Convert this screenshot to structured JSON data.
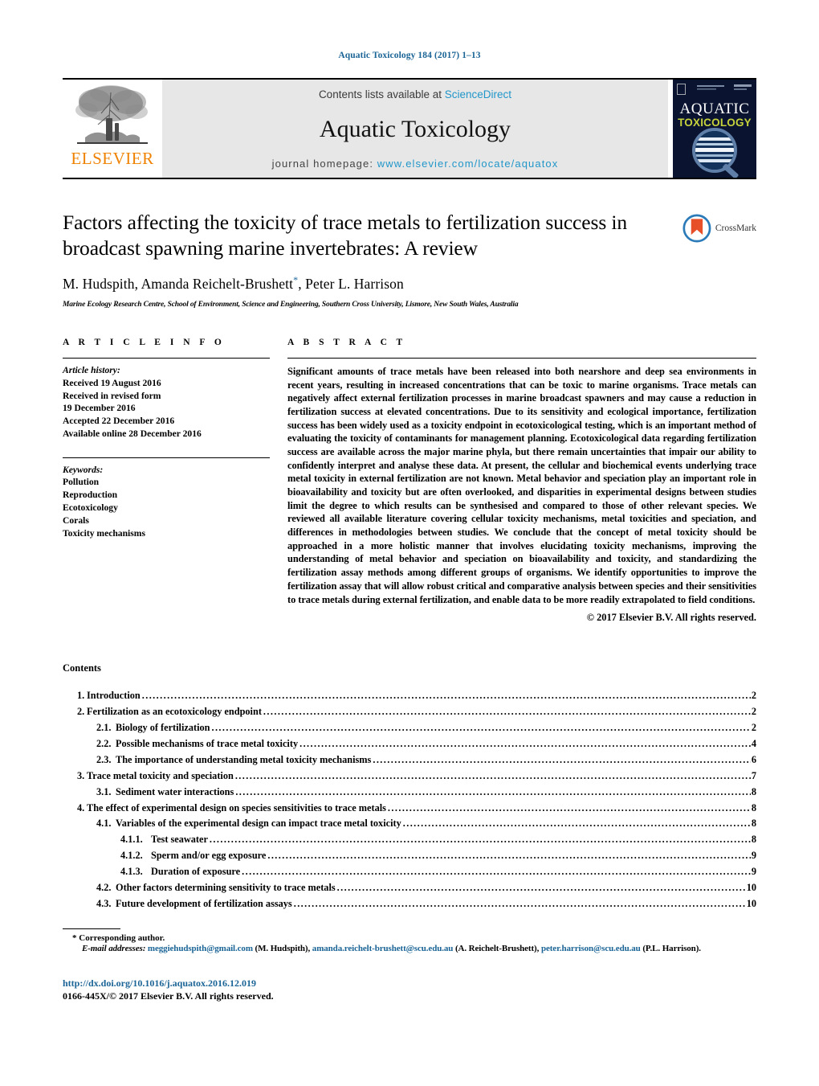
{
  "running_head": "Aquatic Toxicology 184 (2017) 1–13",
  "masthead": {
    "publisher_name": "ELSEVIER",
    "contents_prefix": "Contents lists available at ",
    "sciencedirect": "ScienceDirect",
    "journal_name": "Aquatic Toxicology",
    "homepage_prefix": "journal homepage: ",
    "homepage_url": "www.elsevier.com/locate/aquatox",
    "cover": {
      "line1": "AQUATIC",
      "line2": "TOXICOLOGY",
      "bg_color": "#0a1430",
      "title_color": "#ffffff",
      "subtitle_color": "#c6d23c"
    }
  },
  "title_block": {
    "title": "Factors affecting the toxicity of trace metals to fertilization success in broadcast spawning marine invertebrates: A review",
    "authors_part1": "M. Hudspith, Amanda Reichelt-Brushett",
    "corresponding_marker": "*",
    "authors_part2": ", Peter L. Harrison",
    "affiliation": "Marine Ecology Research Centre, School of Environment, Science and Engineering, Southern Cross University, Lismore, New South Wales, Australia",
    "crossmark_label": "CrossMark"
  },
  "article_info": {
    "heading": "A R T I C L E  I N F O",
    "history_label": "Article history:",
    "history": [
      "Received 19 August 2016",
      "Received in revised form",
      "19 December 2016",
      "Accepted 22 December 2016",
      "Available online 28 December 2016"
    ],
    "keywords_label": "Keywords:",
    "keywords": [
      "Pollution",
      "Reproduction",
      "Ecotoxicology",
      "Corals",
      "Toxicity mechanisms"
    ]
  },
  "abstract": {
    "heading": "A B S T R A C T",
    "text": "Significant amounts of trace metals have been released into both nearshore and deep sea environments in recent years, resulting in increased concentrations that can be toxic to marine organisms. Trace metals can negatively affect external fertilization processes in marine broadcast spawners and may cause a reduction in fertilization success at elevated concentrations. Due to its sensitivity and ecological importance, fertilization success has been widely used as a toxicity endpoint in ecotoxicological testing, which is an important method of evaluating the toxicity of contaminants for management planning. Ecotoxicological data regarding fertilization success are available across the major marine phyla, but there remain uncertainties that impair our ability to confidently interpret and analyse these data. At present, the cellular and biochemical events underlying trace metal toxicity in external fertilization are not known. Metal behavior and speciation play an important role in bioavailability and toxicity but are often overlooked, and disparities in experimental designs between studies limit the degree to which results can be synthesised and compared to those of other relevant species. We reviewed all available literature covering cellular toxicity mechanisms, metal toxicities and speciation, and differences in methodologies between studies. We conclude that the concept of metal toxicity should be approached in a more holistic manner that involves elucidating toxicity mechanisms, improving the understanding of metal behavior and speciation on bioavailability and toxicity, and standardizing the fertilization assay methods among different groups of organisms. We identify opportunities to improve the fertilization assay that will allow robust critical and comparative analysis between species and their sensitivities to trace metals during external fertilization, and enable data to be more readily extrapolated to field conditions.",
    "copyright": "© 2017 Elsevier B.V. All rights reserved."
  },
  "contents": {
    "heading": "Contents",
    "entries": [
      {
        "level": 1,
        "number": "1.",
        "label": "Introduction",
        "page": "2"
      },
      {
        "level": 1,
        "number": "2.",
        "label": "Fertilization as an ecotoxicology endpoint",
        "page": "2"
      },
      {
        "level": 2,
        "number": "2.1.",
        "label": "Biology of fertilization",
        "page": "2"
      },
      {
        "level": 2,
        "number": "2.2.",
        "label": "Possible mechanisms of trace metal toxicity",
        "page": "4"
      },
      {
        "level": 2,
        "number": "2.3.",
        "label": "The importance of understanding metal toxicity mechanisms",
        "page": "6"
      },
      {
        "level": 1,
        "number": "3.",
        "label": "Trace metal toxicity and speciation",
        "page": "7"
      },
      {
        "level": 2,
        "number": "3.1.",
        "label": "Sediment water interactions",
        "page": "8"
      },
      {
        "level": 1,
        "number": "4.",
        "label": "The effect of experimental design on species sensitivities to trace metals",
        "page": "8"
      },
      {
        "level": 2,
        "number": "4.1.",
        "label": "Variables of the experimental design can impact trace metal toxicity",
        "page": "8"
      },
      {
        "level": 3,
        "number": "4.1.1.",
        "label": "Test seawater",
        "page": "8"
      },
      {
        "level": 3,
        "number": "4.1.2.",
        "label": "Sperm and/or egg exposure",
        "page": "9"
      },
      {
        "level": 3,
        "number": "4.1.3.",
        "label": "Duration of exposure",
        "page": "9"
      },
      {
        "level": 2,
        "number": "4.2.",
        "label": "Other factors determining sensitivity to trace metals",
        "page": "10"
      },
      {
        "level": 2,
        "number": "4.3.",
        "label": "Future development of fertilization assays",
        "page": "10"
      }
    ]
  },
  "footer": {
    "corresponding_note": "* Corresponding author.",
    "emails_label": "E-mail addresses:",
    "emails": [
      {
        "address": "meggiehudspith@gmail.com",
        "person": "(M. Hudspith),"
      },
      {
        "address": "amanda.reichelt-brushett@scu.edu.au",
        "person": "(A. Reichelt-Brushett),"
      },
      {
        "address": "peter.harrison@scu.edu.au",
        "person": "(P.L. Harrison)."
      }
    ],
    "doi": "http://dx.doi.org/10.1016/j.aquatox.2016.12.019",
    "issn_line": "0166-445X/© 2017 Elsevier B.V. All rights reserved."
  },
  "colors": {
    "link_blue": "#1a6496",
    "sciencedirect_blue": "#2196c9",
    "elsevier_orange": "#ef8200"
  }
}
